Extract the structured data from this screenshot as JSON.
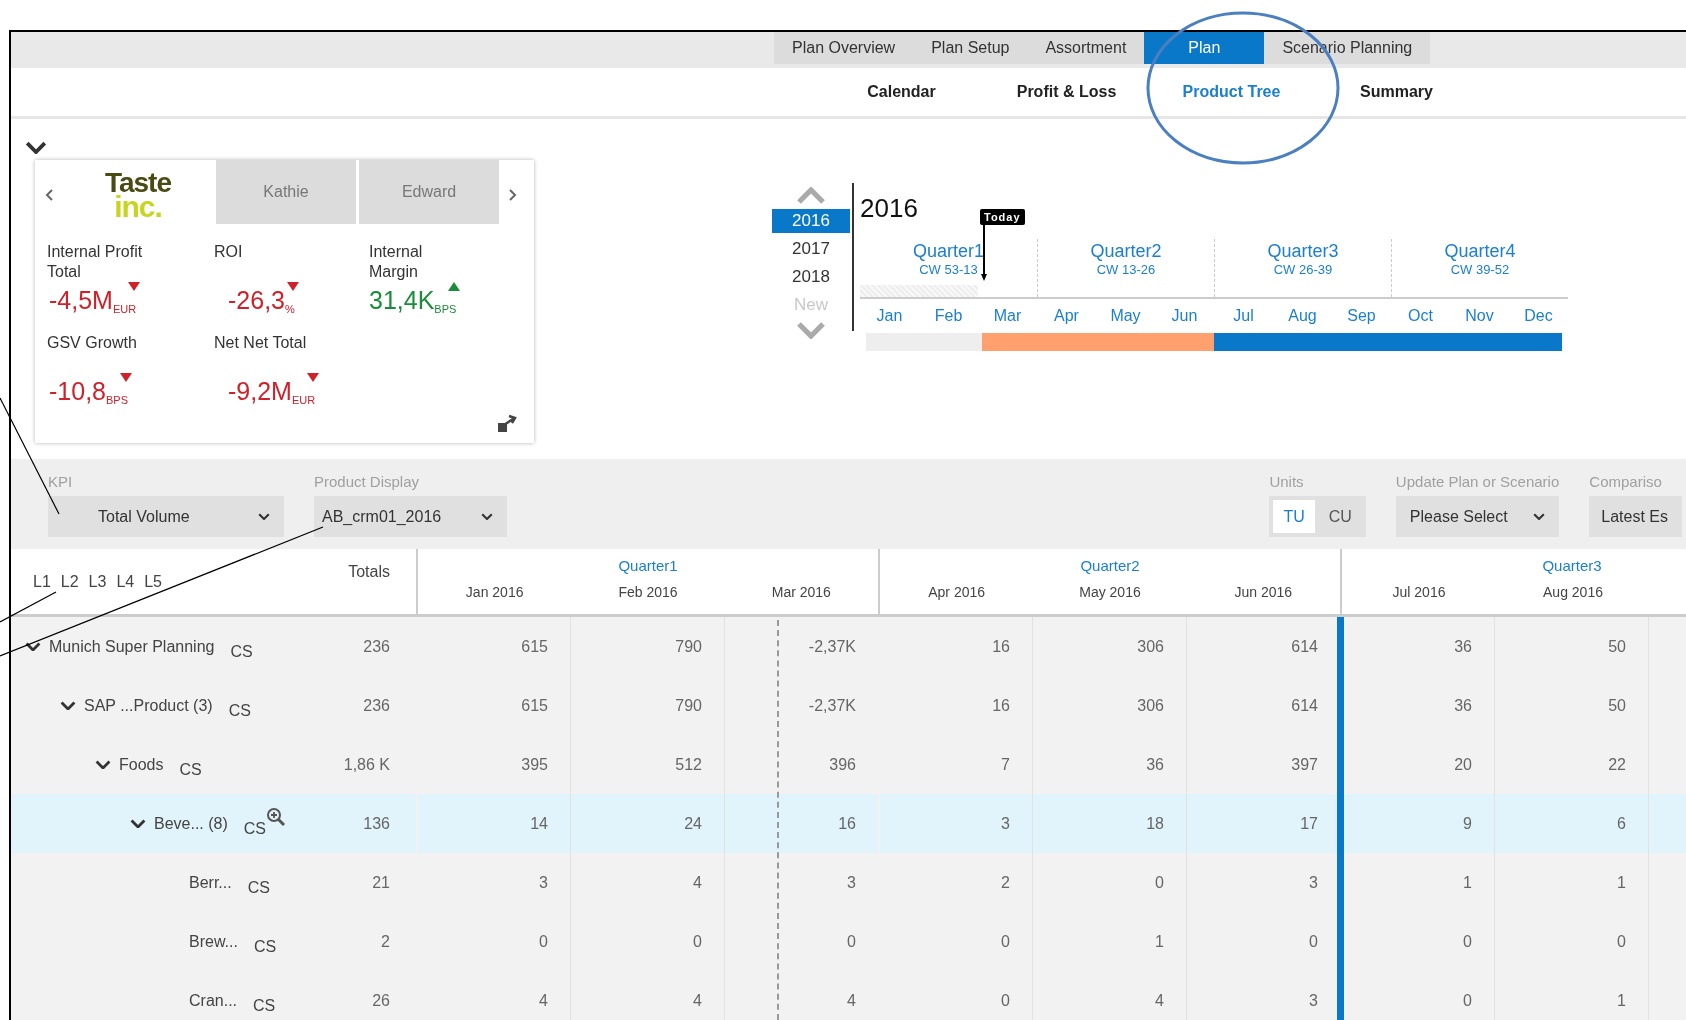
{
  "top_tabs": [
    {
      "label": "Plan Overview",
      "selected": false
    },
    {
      "label": "Plan Setup",
      "selected": false
    },
    {
      "label": "Assortment",
      "selected": false
    },
    {
      "label": "Plan",
      "selected": true
    },
    {
      "label": "Scenario Planning",
      "selected": false
    }
  ],
  "sub_tabs": [
    {
      "label": "Calendar",
      "selected": false
    },
    {
      "label": "Profit & Loss",
      "selected": false
    },
    {
      "label": "Product Tree",
      "selected": true
    },
    {
      "label": "Summary",
      "selected": false
    }
  ],
  "kpi_card": {
    "logo": [
      "Taste",
      "inc."
    ],
    "people": [
      "Kathie",
      "Edward"
    ],
    "metrics": [
      {
        "label": "Internal Profit Total",
        "value": "-4,5M",
        "unit": "EUR",
        "trend_up": false
      },
      {
        "label": "ROI",
        "value": "-26,3",
        "unit": "%",
        "trend_up": false
      },
      {
        "label": "Internal Margin",
        "value": "31,4K",
        "unit": "BPS",
        "trend_up": true
      },
      {
        "label": "GSV Growth",
        "value": "-10,8",
        "unit": "BPS",
        "trend_up": false
      },
      {
        "label": "Net Net Total",
        "value": "-9,2M",
        "unit": "EUR",
        "trend_up": false
      }
    ]
  },
  "timeline": {
    "years": [
      {
        "label": "2016",
        "selected": true,
        "disabled": false
      },
      {
        "label": "2017",
        "selected": false,
        "disabled": false
      },
      {
        "label": "2018",
        "selected": false,
        "disabled": false
      },
      {
        "label": "New",
        "selected": false,
        "disabled": true
      }
    ],
    "title": "2016",
    "today_label": "Today",
    "quarters": [
      {
        "name": "Quarter1",
        "weeks": "CW 53-13"
      },
      {
        "name": "Quarter2",
        "weeks": "CW 13-26"
      },
      {
        "name": "Quarter3",
        "weeks": "CW 26-39"
      },
      {
        "name": "Quarter4",
        "weeks": "CW 39-52"
      }
    ],
    "months": [
      {
        "label": "Jan",
        "color": "#eeeeee",
        "today": false
      },
      {
        "label": "Feb",
        "color": "#eeeeee",
        "today": false
      },
      {
        "label": "Mar",
        "color": "#ffa06e",
        "today": true
      },
      {
        "label": "Apr",
        "color": "#ffa06e",
        "today": false
      },
      {
        "label": "May",
        "color": "#ffa06e",
        "today": false
      },
      {
        "label": "Jun",
        "color": "#ffa06e",
        "today": false
      },
      {
        "label": "Jul",
        "color": "#0a78c8",
        "today": false
      },
      {
        "label": "Aug",
        "color": "#0a78c8",
        "today": false
      },
      {
        "label": "Sep",
        "color": "#0a78c8",
        "today": false
      },
      {
        "label": "Oct",
        "color": "#0a78c8",
        "today": false
      },
      {
        "label": "Nov",
        "color": "#0a78c8",
        "today": false
      },
      {
        "label": "Dec",
        "color": "#0a78c8",
        "today": false
      }
    ]
  },
  "filters": [
    {
      "label": "KPI",
      "value": "Total Volume",
      "kind": "dropdown"
    },
    {
      "label": "Product Display",
      "value": "AB_crm01_2016",
      "kind": "dropdown"
    },
    {
      "label": "Units",
      "kind": "toggle",
      "options": [
        {
          "label": "TU",
          "selected": true
        },
        {
          "label": "CU",
          "selected": false
        }
      ]
    },
    {
      "label": "Update Plan or Scenario",
      "value": "Please Select",
      "kind": "dropdown"
    },
    {
      "label": "Compariso",
      "value": "Latest Es",
      "kind": "cut"
    }
  ],
  "table": {
    "levels": [
      "L1",
      "L2",
      "L3",
      "L4",
      "L5"
    ],
    "totals_heading": "Totals",
    "quarters": [
      {
        "name": "Quarter1",
        "months": [
          {
            "label": "Jan 2016",
            "today": false,
            "period_end": false
          },
          {
            "label": "Feb 2016",
            "today": false,
            "period_end": false
          },
          {
            "label": "Mar 2016",
            "today": true,
            "period_end": false
          }
        ]
      },
      {
        "name": "Quarter2",
        "months": [
          {
            "label": "Apr 2016",
            "today": false,
            "period_end": false
          },
          {
            "label": "May 2016",
            "today": false,
            "period_end": false
          },
          {
            "label": "Jun 2016",
            "today": false,
            "period_end": true
          }
        ]
      },
      {
        "name": "Quarter3",
        "months": [
          {
            "label": "Jul 2016",
            "today": false,
            "period_end": false
          },
          {
            "label": "Aug 2016",
            "today": false,
            "period_end": false
          }
        ]
      }
    ],
    "rows": [
      {
        "name": "Munich Super Planning",
        "unit": "CS",
        "total": "236",
        "values": [
          "615",
          "790",
          "-2,37K",
          "16",
          "306",
          "614",
          "36",
          "50"
        ],
        "expanded": true,
        "selected": false,
        "children": [
          {
            "name": "SAP ...Product (3)",
            "unit": "CS",
            "total": "236",
            "values": [
              "615",
              "790",
              "-2,37K",
              "16",
              "306",
              "614",
              "36",
              "50"
            ],
            "expanded": true,
            "selected": false,
            "children": [
              {
                "name": "Foods",
                "unit": "CS",
                "total": "1,86 K",
                "values": [
                  "395",
                  "512",
                  "396",
                  "7",
                  "36",
                  "397",
                  "20",
                  "22"
                ],
                "expanded": true,
                "selected": false,
                "children": [
                  {
                    "name": "Beve... (8)",
                    "unit": "CS",
                    "total": "136",
                    "values": [
                      "14",
                      "24",
                      "16",
                      "3",
                      "18",
                      "17",
                      "9",
                      "6"
                    ],
                    "expanded": true,
                    "selected": true,
                    "children": [
                      {
                        "name": "Berr...",
                        "unit": "CS",
                        "total": "21",
                        "values": [
                          "3",
                          "4",
                          "3",
                          "2",
                          "0",
                          "3",
                          "1",
                          "1"
                        ],
                        "selected": false
                      },
                      {
                        "name": "Brew...",
                        "unit": "CS",
                        "total": "2",
                        "values": [
                          "0",
                          "0",
                          "0",
                          "0",
                          "1",
                          "0",
                          "0",
                          "0"
                        ],
                        "selected": false
                      },
                      {
                        "name": "Cran...",
                        "unit": "CS",
                        "total": "26",
                        "values": [
                          "4",
                          "4",
                          "4",
                          "0",
                          "4",
                          "3",
                          "0",
                          "1"
                        ],
                        "selected": false
                      }
                    ]
                  }
                ]
              }
            ]
          }
        ]
      }
    ]
  }
}
